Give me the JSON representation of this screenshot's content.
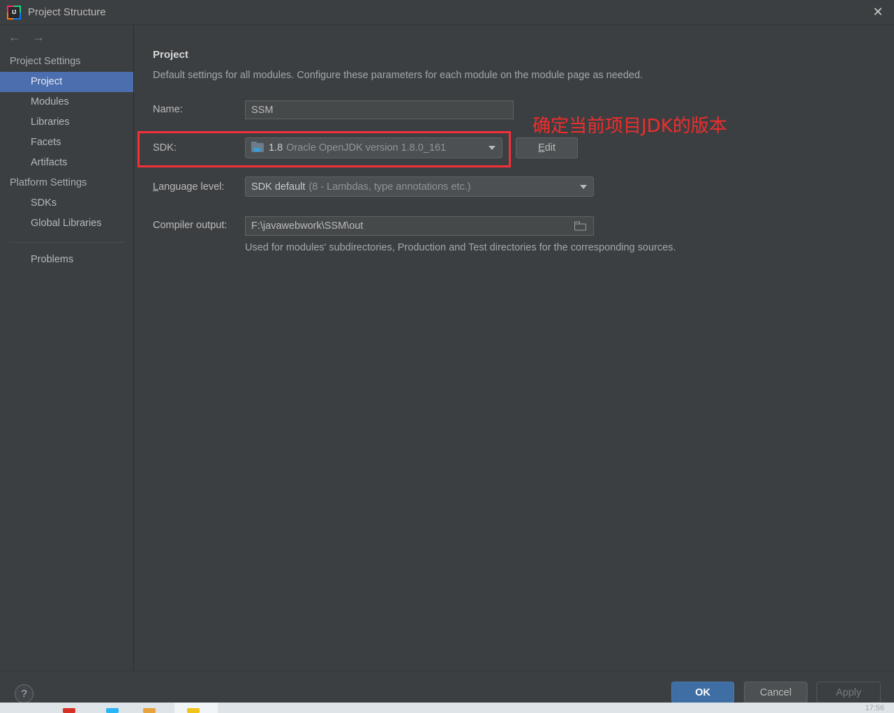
{
  "window": {
    "title": "Project Structure",
    "app_icon": "intellij-idea-icon",
    "icon_label": "IJ",
    "close_label": "✕"
  },
  "sidebar": {
    "nav": {
      "back": "←",
      "forward": "→"
    },
    "groups": [
      {
        "label": "Project Settings",
        "items": [
          {
            "label": "Project",
            "selected": true
          },
          {
            "label": "Modules",
            "selected": false
          },
          {
            "label": "Libraries",
            "selected": false
          },
          {
            "label": "Facets",
            "selected": false
          },
          {
            "label": "Artifacts",
            "selected": false
          }
        ]
      },
      {
        "label": "Platform Settings",
        "items": [
          {
            "label": "SDKs",
            "selected": false
          },
          {
            "label": "Global Libraries",
            "selected": false
          }
        ]
      }
    ],
    "problems": "Problems"
  },
  "main": {
    "title": "Project",
    "description": "Default settings for all modules. Configure these parameters for each module on the module page as needed.",
    "name": {
      "label": "Name:",
      "value": "SSM",
      "placeholder": ""
    },
    "sdk": {
      "label": "SDK:",
      "icon": "java-sdk-folder-icon",
      "version": "1.8",
      "detail": "Oracle OpenJDK version 1.8.0_161",
      "edit_button": "Edit",
      "edit_mnemonic": "E"
    },
    "language_level": {
      "label": "Language level:",
      "label_mnemonic": "L",
      "value": "SDK default",
      "detail": "(8 - Lambdas, type annotations etc.)"
    },
    "compiler_output": {
      "label": "Compiler output:",
      "value": "F:\\javawebwork\\SSM\\out",
      "browse_icon": "folder-browse-icon",
      "hint": "Used for modules' subdirectories, Production and Test directories for the corresponding sources."
    }
  },
  "annotation": {
    "note": "确定当前项目JDK的版本",
    "color": "#ef2d2d",
    "box_color": "#f3303a"
  },
  "footer": {
    "help": "?",
    "ok": "OK",
    "cancel": "Cancel",
    "apply": "Apply"
  },
  "taskbar": {
    "clock": "17:56"
  },
  "colors": {
    "background": "#3c3f41",
    "selection": "#4b6eaf",
    "field": "#45494a",
    "ok_button": "#3f6ea5"
  }
}
